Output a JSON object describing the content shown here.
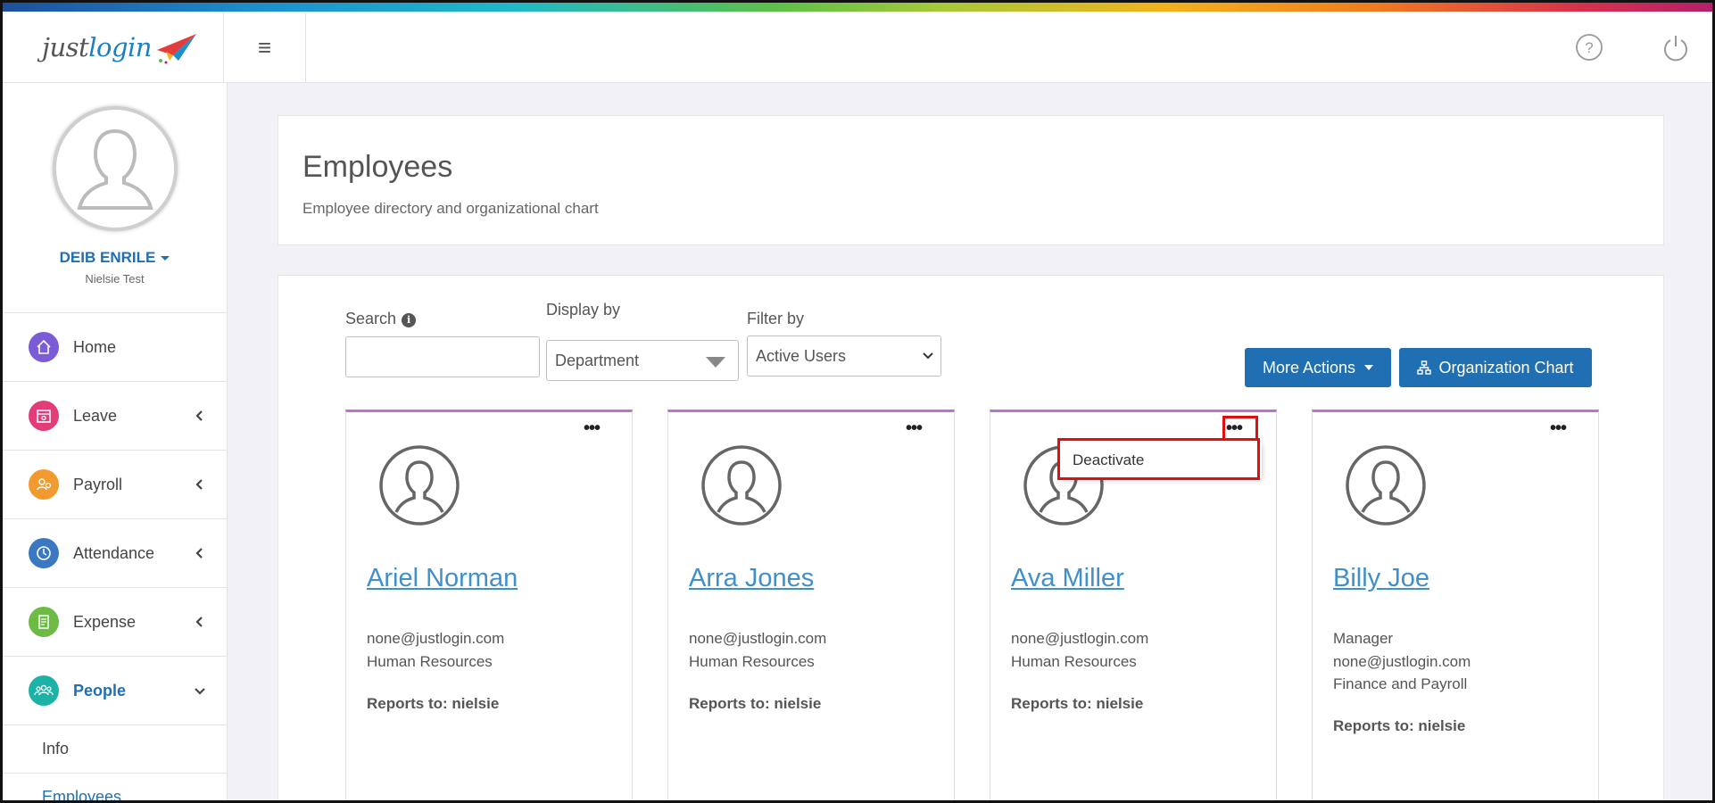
{
  "brand": {
    "logo_just": "just",
    "logo_login": "login"
  },
  "colors": {
    "primary": "#1f6fb2",
    "link": "#3f8fcc",
    "card_accent": "#b974cc",
    "highlight": "#e01010"
  },
  "topbar": {
    "menu_icon": "hamburger-icon",
    "help_icon": "help-icon",
    "power_icon": "power-icon"
  },
  "user": {
    "name": "DEIB ENRILE",
    "org": "Nielsie Test"
  },
  "nav": [
    {
      "label": "Home",
      "icon": "home-icon",
      "color": "#7b5cd6"
    },
    {
      "label": "Leave",
      "icon": "calendar-icon",
      "color": "#e23c7a"
    },
    {
      "label": "Payroll",
      "icon": "payroll-icon",
      "color": "#f29a2e"
    },
    {
      "label": "Attendance",
      "icon": "clock-icon",
      "color": "#3a78c2"
    },
    {
      "label": "Expense",
      "icon": "receipt-icon",
      "color": "#6dbb45"
    },
    {
      "label": "People",
      "icon": "people-icon",
      "color": "#1cb3a6"
    }
  ],
  "subnav": [
    {
      "label": "Info"
    },
    {
      "label": "Employees"
    }
  ],
  "header": {
    "title": "Employees",
    "subtitle": "Employee directory and organizational chart"
  },
  "filters": {
    "search_label": "Search",
    "search_value": "",
    "display_label": "Display by",
    "display_value": "Department",
    "filter_label": "Filter by",
    "filter_value": "Active Users"
  },
  "actions": {
    "more_actions": "More Actions",
    "org_chart": "Organization Chart"
  },
  "employees": [
    {
      "name": "Ariel Norman",
      "lines": [
        "none@justlogin.com",
        "Human Resources"
      ],
      "reports": "Reports to: nielsie"
    },
    {
      "name": "Arra Jones",
      "lines": [
        "none@justlogin.com",
        "Human Resources"
      ],
      "reports": "Reports to: nielsie"
    },
    {
      "name": "Ava Miller",
      "lines": [
        "none@justlogin.com",
        "Human Resources"
      ],
      "reports": "Reports to: nielsie"
    },
    {
      "name": "Billy Joe",
      "lines": [
        "Manager",
        "none@justlogin.com",
        "Finance and Payroll"
      ],
      "reports": "Reports to: nielsie"
    }
  ],
  "card_menu": {
    "deactivate": "Deactivate"
  }
}
